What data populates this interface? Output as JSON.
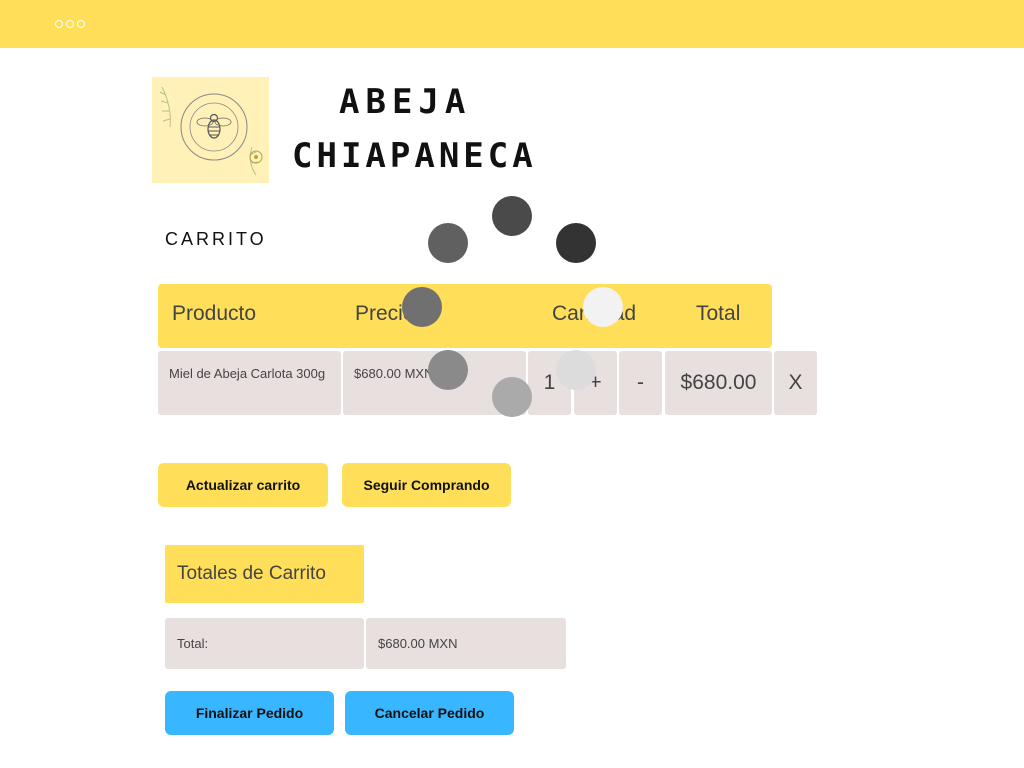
{
  "window": {
    "menu_icon": "three-dots-icon"
  },
  "brand": {
    "logo_icon": "bee-seal-logo",
    "name_line1": "ABEJA",
    "name_line2": "CHIAPANECA"
  },
  "cart": {
    "title": "CARRITO",
    "columns": [
      "Producto",
      "Precio",
      "Cantidad",
      "Total"
    ],
    "rows": [
      {
        "product": "Miel de Abeja Carlota 300g",
        "price": "$680.00 MXN",
        "quantity": "1",
        "plus_label": "+",
        "minus_label": "-",
        "total": "$680.00",
        "remove_label": "X"
      }
    ],
    "update_label": "Actualizar carrito",
    "continue_label": "Seguir Comprando"
  },
  "totals": {
    "title": "Totales de Carrito",
    "label": "Total:",
    "value": "$680.00 MXN",
    "finish_label": "Finalizar Pedido",
    "cancel_label": "Cancelar Pedido"
  },
  "loading_spinner": {
    "icon": "loading-spinner-icon"
  },
  "colors": {
    "accent_yellow": "#ffde59",
    "cell_gray": "#e8dfdf",
    "button_blue": "#38b6ff"
  }
}
